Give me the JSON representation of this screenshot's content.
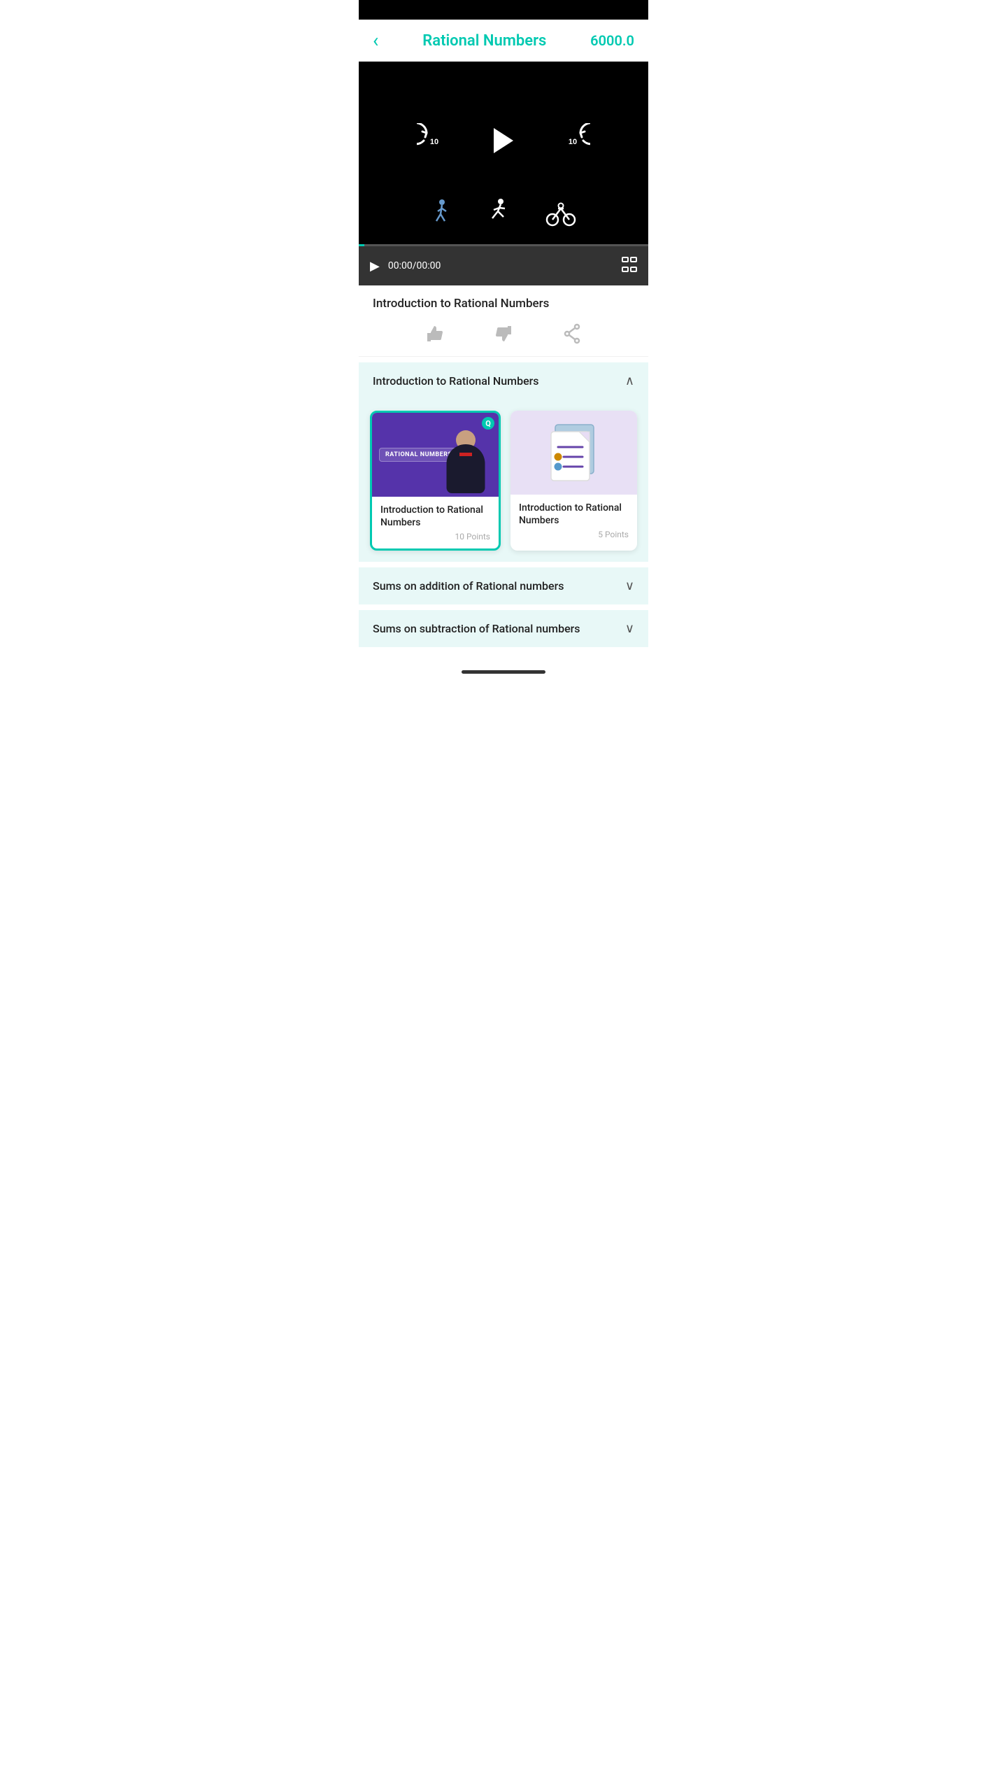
{
  "statusBar": {},
  "header": {
    "back_label": "‹",
    "title": "Rational Numbers",
    "score": "6000.0"
  },
  "videoPlayer": {
    "rewind_label": "10",
    "forward_label": "10",
    "time": "00:00/00:00",
    "progress_percent": 2,
    "speed_icons": [
      "walk",
      "run",
      "bike"
    ],
    "active_speed": 0
  },
  "videoTitle": "Introduction to Rational Numbers",
  "reactions": {
    "like_label": "👍",
    "dislike_label": "👎",
    "share_label": "share"
  },
  "sections": [
    {
      "title": "Introduction to Rational Numbers",
      "expanded": true,
      "cards": [
        {
          "id": "video-card",
          "type": "video",
          "name": "Introduction to Rational Numbers",
          "points": "10 Points",
          "thumbnail_label": "RATIONAL NUMBERS",
          "active": true
        },
        {
          "id": "doc-card",
          "type": "document",
          "name": "Introduction to Rational Numbers",
          "points": "5 Points",
          "active": false
        }
      ]
    },
    {
      "title": "Sums on addition of Rational numbers",
      "expanded": false,
      "cards": []
    },
    {
      "title": "Sums on subtraction of Rational numbers",
      "expanded": false,
      "cards": []
    }
  ]
}
